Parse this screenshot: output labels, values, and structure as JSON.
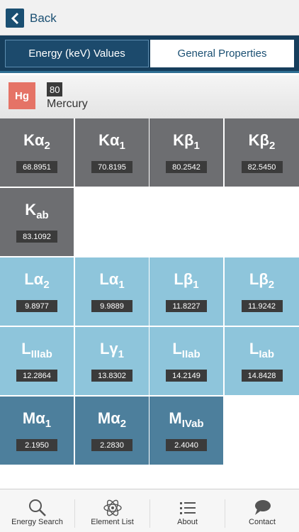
{
  "nav": {
    "back_label": "Back"
  },
  "segments": {
    "energy_label": "Energy (keV) Values",
    "general_label": "General Properties"
  },
  "element": {
    "symbol": "Hg",
    "atomic_number": "80",
    "name": "Mercury"
  },
  "lines": [
    {
      "base": "Kα",
      "sub": "2",
      "value": "68.8951"
    },
    {
      "base": "Kα",
      "sub": "1",
      "value": "70.8195"
    },
    {
      "base": "Kβ",
      "sub": "1",
      "value": "80.2542"
    },
    {
      "base": "Kβ",
      "sub": "2",
      "value": "82.5450"
    },
    {
      "base": "K",
      "sub": "ab",
      "value": "83.1092"
    },
    {
      "base": "Lα",
      "sub": "2",
      "value": "9.8977"
    },
    {
      "base": "Lα",
      "sub": "1",
      "value": "9.9889"
    },
    {
      "base": "Lβ",
      "sub": "1",
      "value": "11.8227"
    },
    {
      "base": "Lβ",
      "sub": "2",
      "value": "11.9242"
    },
    {
      "base": "L",
      "sub": "IIIab",
      "value": "12.2864"
    },
    {
      "base": "Lγ",
      "sub": "1",
      "value": "13.8302"
    },
    {
      "base": "L",
      "sub": "IIab",
      "value": "14.2149"
    },
    {
      "base": "L",
      "sub": "Iab",
      "value": "14.8428"
    },
    {
      "base": "Mα",
      "sub": "1",
      "value": "2.1950"
    },
    {
      "base": "Mα",
      "sub": "2",
      "value": "2.2830"
    },
    {
      "base": "M",
      "sub": "IVab",
      "value": "2.4040"
    }
  ],
  "tabs": [
    {
      "label": "Energy Search",
      "icon": "search-icon"
    },
    {
      "label": "Element List",
      "icon": "atom-icon"
    },
    {
      "label": "About",
      "icon": "list-icon"
    },
    {
      "label": "Contact",
      "icon": "chat-icon"
    }
  ],
  "colors": {
    "k_lines": "#6d6e71",
    "l_lines": "#8ec5db",
    "m_lines": "#4d7f9c",
    "element_badge": "#e57366",
    "brand": "#1a4f72"
  }
}
